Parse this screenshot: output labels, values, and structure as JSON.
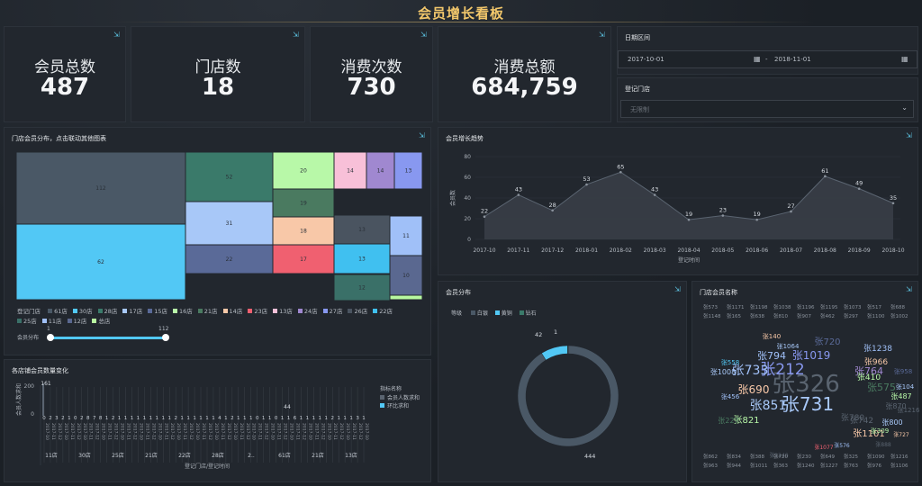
{
  "title": "会员增长看板",
  "kpis": [
    {
      "label": "会员总数",
      "value": "487"
    },
    {
      "label": "门店数",
      "value": "18"
    },
    {
      "label": "消费次数",
      "value": "730"
    },
    {
      "label": "消费总额",
      "value": "684,759"
    }
  ],
  "filters": {
    "date_title": "日期区间",
    "date_start": "2017-10-01",
    "date_sep": "-",
    "date_end": "2018-11-01",
    "store_title": "登记门店",
    "store_placeholder": "无限制"
  },
  "treemap": {
    "title": "门店会员分布，点击联动其他图表",
    "legend_title": "登记门店",
    "legend": [
      {
        "name": "61店",
        "color": "#4a5866"
      },
      {
        "name": "30店",
        "color": "#52c8f5"
      },
      {
        "name": "28店",
        "color": "#3a7a6a"
      },
      {
        "name": "17店",
        "color": "#a8c8f8"
      },
      {
        "name": "15店",
        "color": "#5a6a98"
      },
      {
        "name": "16店",
        "color": "#b8f8a8"
      },
      {
        "name": "21店",
        "color": "#4a7a60"
      },
      {
        "name": "14店",
        "color": "#f8c8a8"
      },
      {
        "name": "23店",
        "color": "#f06070"
      },
      {
        "name": "13店",
        "color": "#f8c0d8"
      },
      {
        "name": "24店",
        "color": "#a088d0"
      },
      {
        "name": "27店",
        "color": "#8898f0"
      },
      {
        "name": "26店",
        "color": "#4a5460"
      },
      {
        "name": "22店",
        "color": "#40c0f0"
      },
      {
        "name": "25店",
        "color": "#3a7068"
      },
      {
        "name": "11店",
        "color": "#a0c0f8"
      },
      {
        "name": "12店",
        "color": "#5a6890"
      },
      {
        "name": "总店",
        "color": "#b8f8a0"
      }
    ],
    "cells": [
      {
        "v": "112",
        "c": "#4a5866"
      },
      {
        "v": "62",
        "c": "#52c8f5"
      },
      {
        "v": "52",
        "c": "#3a7a6a"
      },
      {
        "v": "31",
        "c": "#a8c8f8"
      },
      {
        "v": "22",
        "c": "#5a6a98"
      },
      {
        "v": "20",
        "c": "#b8f8a8"
      },
      {
        "v": "19",
        "c": "#4a7a60"
      },
      {
        "v": "18",
        "c": "#f8c8a8"
      },
      {
        "v": "17",
        "c": "#f06070"
      },
      {
        "v": "14",
        "c": "#f8c0d8"
      },
      {
        "v": "14",
        "c": "#a088d0"
      },
      {
        "v": "13",
        "c": "#8898f0"
      },
      {
        "v": "13",
        "c": "#4a5460"
      },
      {
        "v": "13",
        "c": "#40c0f0"
      },
      {
        "v": "12",
        "c": "#3a7068"
      },
      {
        "v": "11",
        "c": "#a0c0f8"
      },
      {
        "v": "10",
        "c": "#5a6890"
      },
      {
        "v": "",
        "c": "#b8f8a0"
      }
    ],
    "slider_label": "会员分布",
    "slider_min": "1",
    "slider_max": "112"
  },
  "trend": {
    "title": "会员增长趋势",
    "ylabel": "会员数",
    "xlabel": "登记时间"
  },
  "chart_data": [
    {
      "type": "area",
      "x": [
        "2017-10",
        "2017-11",
        "2017-12",
        "2018-01",
        "2018-02",
        "2018-03",
        "2018-04",
        "2018-05",
        "2018-06",
        "2018-07",
        "2018-08",
        "2018-09",
        "2018-10"
      ],
      "values": [
        22,
        43,
        28,
        53,
        65,
        43,
        19,
        23,
        19,
        27,
        61,
        49,
        35
      ],
      "ylim": [
        0,
        80
      ],
      "yticks": [
        "0",
        "20",
        "40",
        "60",
        "80"
      ],
      "xlabel": "登记时间",
      "ylabel": "会员数"
    },
    {
      "type": "pie",
      "title": "会员分布",
      "legend_title": "等级",
      "categories": [
        "白银",
        "黄铜",
        "钻石"
      ],
      "values": [
        444,
        42,
        1
      ],
      "colors": [
        "#4a5866",
        "#52c8f5",
        "#3a7a6a"
      ]
    },
    {
      "type": "bar",
      "title": "各店铺会员数量变化",
      "ylabel": "会员人数求和",
      "xlabel": "登记门店/登记时间",
      "yticks": [
        "0",
        "200"
      ],
      "series": [
        {
          "name": "会员人数求和",
          "color": "#5a6470"
        },
        {
          "name": "环比求和",
          "color": "#52c8f5"
        }
      ],
      "top_labels": [
        "161",
        "44"
      ],
      "group_labels": [
        "11店",
        "30店",
        "25店",
        "21店",
        "22店",
        "28店",
        "2..",
        "61店",
        "21店",
        "13店"
      ],
      "legend_title": "指标名称"
    }
  ],
  "pie_labels": {
    "a": "42",
    "b": "1",
    "c": "444"
  },
  "wordcloud": {
    "title": "门店会员名称"
  },
  "words": [
    {
      "t": "张326",
      "s": 26,
      "c": "#5a6470"
    },
    {
      "t": "张731",
      "s": 20,
      "c": "#a8c8f8"
    },
    {
      "t": "张212",
      "s": 17,
      "c": "#8898f0"
    },
    {
      "t": "张733",
      "s": 14,
      "c": "#a0c0f8"
    },
    {
      "t": "张851",
      "s": 14,
      "c": "#a8c8f8"
    },
    {
      "t": "张690",
      "s": 12,
      "c": "#f8c8a8"
    },
    {
      "t": "张1019",
      "s": 12,
      "c": "#8898f0"
    },
    {
      "t": "张794",
      "s": 11,
      "c": "#a0c0f8"
    },
    {
      "t": "张764",
      "s": 11,
      "c": "#a088d0"
    },
    {
      "t": "张575",
      "s": 11,
      "c": "#4a7a60"
    },
    {
      "t": "张1101",
      "s": 10,
      "c": "#f8c8a8"
    },
    {
      "t": "张821",
      "s": 10,
      "c": "#b8f8a8"
    },
    {
      "t": "张720",
      "s": 10,
      "c": "#5a6a98"
    },
    {
      "t": "张1238",
      "s": 9,
      "c": "#a0c0f8"
    },
    {
      "t": "张1008",
      "s": 8,
      "c": "#a8c8f8"
    },
    {
      "t": "张780",
      "s": 9,
      "c": "#5a6470"
    },
    {
      "t": "张742",
      "s": 9,
      "c": "#5a6470"
    },
    {
      "t": "张410",
      "s": 9,
      "c": "#b8f8a8"
    },
    {
      "t": "张966",
      "s": 9,
      "c": "#f8c8a8"
    },
    {
      "t": "张487",
      "s": 8,
      "c": "#b8f8a8"
    },
    {
      "t": "张800",
      "s": 8,
      "c": "#a8c8f8"
    },
    {
      "t": "张1064",
      "s": 7,
      "c": "#a8c8f8"
    },
    {
      "t": "张558",
      "s": 7,
      "c": "#52c8f5"
    },
    {
      "t": "张456",
      "s": 7,
      "c": "#a0c0f8"
    },
    {
      "t": "张227",
      "s": 8,
      "c": "#4a7a60"
    },
    {
      "t": "张140",
      "s": 7,
      "c": "#f8c8a8"
    },
    {
      "t": "张309",
      "s": 7,
      "c": "#b8f8a8"
    },
    {
      "t": "张870",
      "s": 8,
      "c": "#5a6470"
    },
    {
      "t": "张958",
      "s": 7,
      "c": "#5a6a98"
    },
    {
      "t": "张104",
      "s": 7,
      "c": "#a8c8f8"
    },
    {
      "t": "张1216",
      "s": 7,
      "c": "#5a6470"
    },
    {
      "t": "张727",
      "s": 6,
      "c": "#f8c8a8"
    },
    {
      "t": "张1077",
      "s": 6,
      "c": "#f06070"
    },
    {
      "t": "张576",
      "s": 6,
      "c": "#a0c0f8"
    },
    {
      "t": "张1240",
      "s": 6,
      "c": "#5a6470"
    },
    {
      "t": "张888",
      "s": 6,
      "c": "#5a6470"
    }
  ]
}
